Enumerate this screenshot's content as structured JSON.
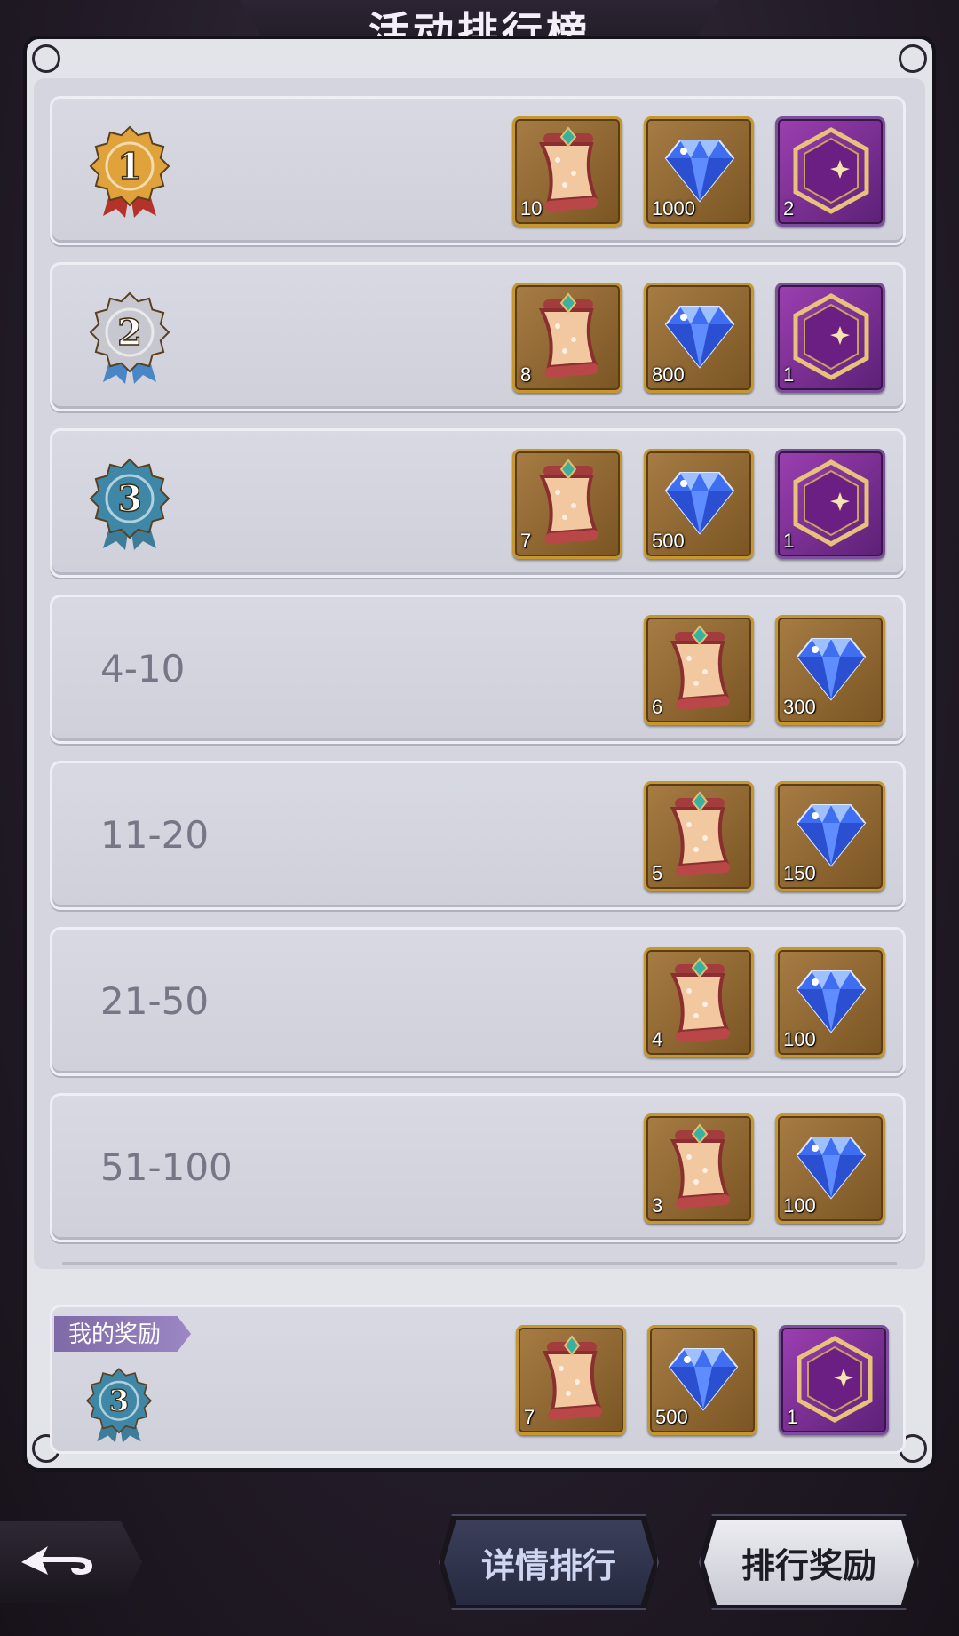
{
  "header": {
    "title": "活动排行榜"
  },
  "ranks": [
    {
      "rank": "1",
      "label": "",
      "rewards": [
        {
          "icon": "scroll-icon",
          "qty": "10"
        },
        {
          "icon": "diamond-icon",
          "qty": "1000"
        },
        {
          "icon": "moon-emblem-icon",
          "qty": "2"
        }
      ]
    },
    {
      "rank": "2",
      "label": "",
      "rewards": [
        {
          "icon": "scroll-icon",
          "qty": "8"
        },
        {
          "icon": "diamond-icon",
          "qty": "800"
        },
        {
          "icon": "moon-emblem-icon",
          "qty": "1"
        }
      ]
    },
    {
      "rank": "3",
      "label": "",
      "rewards": [
        {
          "icon": "scroll-icon",
          "qty": "7"
        },
        {
          "icon": "diamond-icon",
          "qty": "500"
        },
        {
          "icon": "moon-emblem-icon",
          "qty": "1"
        }
      ]
    },
    {
      "rank": "",
      "label": "4-10",
      "rewards": [
        {
          "icon": "scroll-icon",
          "qty": "6"
        },
        {
          "icon": "diamond-icon",
          "qty": "300"
        }
      ]
    },
    {
      "rank": "",
      "label": "11-20",
      "rewards": [
        {
          "icon": "scroll-icon",
          "qty": "5"
        },
        {
          "icon": "diamond-icon",
          "qty": "150"
        }
      ]
    },
    {
      "rank": "",
      "label": "21-50",
      "rewards": [
        {
          "icon": "scroll-icon",
          "qty": "4"
        },
        {
          "icon": "diamond-icon",
          "qty": "100"
        }
      ]
    },
    {
      "rank": "",
      "label": "51-100",
      "rewards": [
        {
          "icon": "scroll-icon",
          "qty": "3"
        },
        {
          "icon": "diamond-icon",
          "qty": "100"
        }
      ]
    }
  ],
  "my_reward": {
    "tag": "我的奖励",
    "rank": "3",
    "rewards": [
      {
        "icon": "scroll-icon",
        "qty": "7"
      },
      {
        "icon": "diamond-icon",
        "qty": "500"
      },
      {
        "icon": "moon-emblem-icon",
        "qty": "1"
      }
    ]
  },
  "footer": {
    "back_icon": "back-arrow-icon",
    "tab_detail": "详情排行",
    "tab_reward": "排行奖励"
  },
  "colors": {
    "gold_medal": "#e0a23a",
    "silver_medal": "#c7c7cf",
    "bronze_medal": "#3f87a6",
    "purple_item": "#8a3aa4",
    "brown_item": "#8c6431"
  }
}
